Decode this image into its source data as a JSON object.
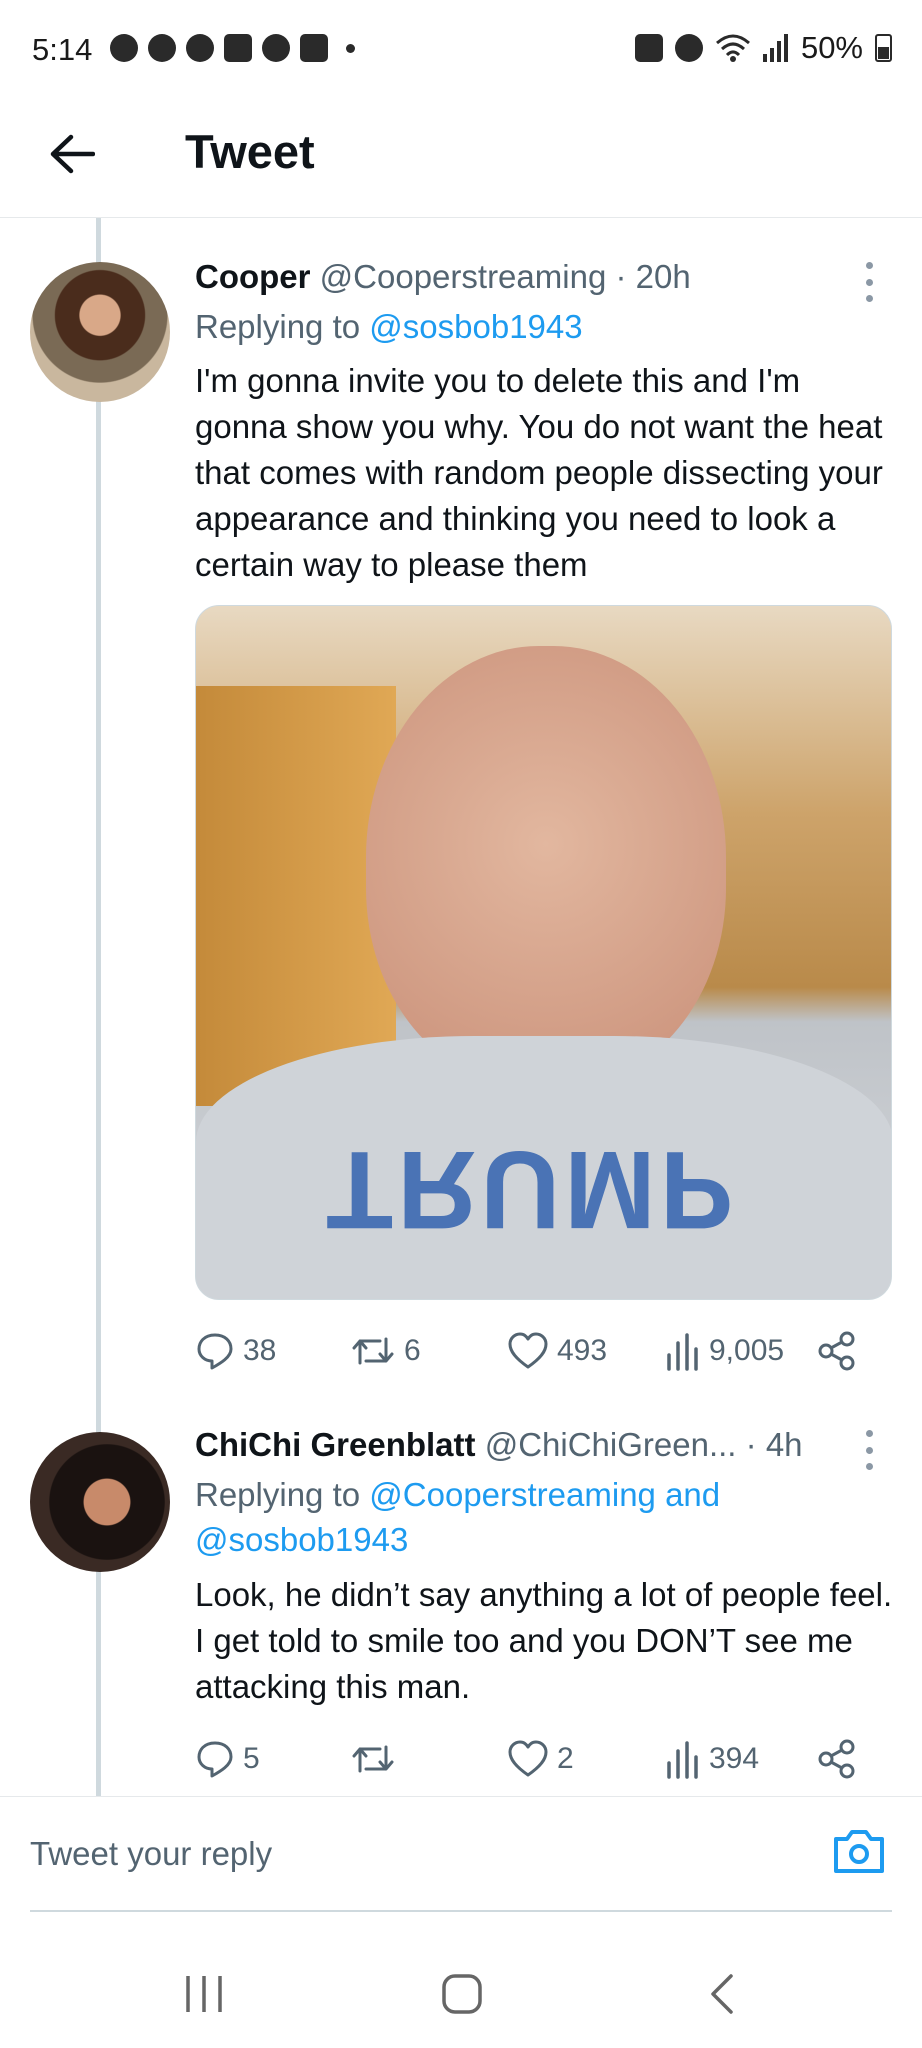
{
  "status_bar": {
    "time": "5:14",
    "battery": "50%"
  },
  "header": {
    "title": "Tweet"
  },
  "tweets": [
    {
      "name": "Cooper",
      "handle": "@Cooperstreaming",
      "separator": "·",
      "time": "20h",
      "reply_prefix": "Replying to",
      "reply_handles": "@sosbob1943",
      "reply_handles_line2": "",
      "text": "I'm gonna invite you to delete this and I'm gonna show you why. You do not want the heat that comes with random people dissecting your appearance and thinking you need to look a certain way to please them",
      "media_print": "TRUMP",
      "stats": {
        "replies": "38",
        "retweets": "6",
        "likes": "493",
        "views": "9,005"
      }
    },
    {
      "name": "ChiChi Greenblatt",
      "handle": "@ChiChiGreen...",
      "separator": "·",
      "time": "4h",
      "reply_prefix": "Replying to",
      "reply_handles": "@Cooperstreaming and",
      "reply_handles_line2": "@sosbob1943",
      "text": "Look, he didn’t say anything a lot of people feel. I get told to smile too and you DON’T see me attacking this man.",
      "stats": {
        "replies": "5",
        "retweets": "",
        "likes": "2",
        "views": "394"
      }
    }
  ],
  "reply_bar": {
    "placeholder": "Tweet your reply"
  },
  "colors": {
    "accent": "#1d9bf0",
    "secondary_text": "#536471",
    "thread_line": "#cfd9de"
  },
  "icons": [
    "back-arrow-icon",
    "more-vertical-icon",
    "reply-icon",
    "retweet-icon",
    "like-icon",
    "views-icon",
    "share-icon",
    "camera-icon",
    "recents-icon",
    "home-icon",
    "back-icon"
  ]
}
